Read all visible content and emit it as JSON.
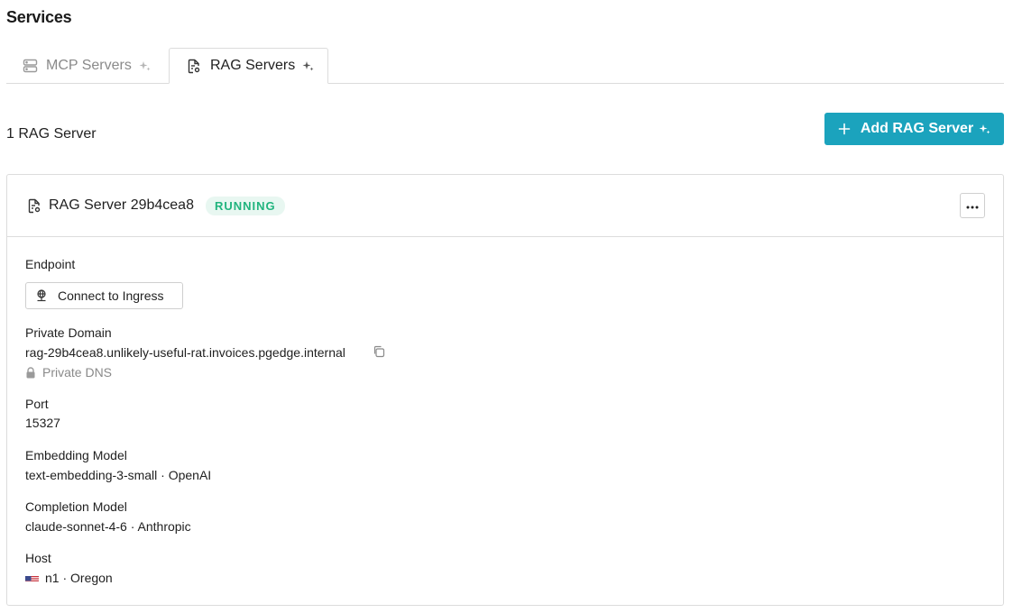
{
  "page": {
    "title": "Services"
  },
  "tabs": [
    {
      "label": "MCP Servers",
      "icon": "server-icon",
      "active": false
    },
    {
      "label": "RAG Servers",
      "icon": "file-gear-icon",
      "active": true
    }
  ],
  "summary": {
    "count_label": "1 RAG Server"
  },
  "add_button": {
    "label": "Add RAG Server",
    "color": "#1ba3bd"
  },
  "server": {
    "title": "RAG Server 29b4cea8",
    "status": "RUNNING",
    "status_color": "#21b47e",
    "endpoint": {
      "label": "Endpoint",
      "button_label": "Connect to Ingress"
    },
    "private_domain": {
      "label": "Private Domain",
      "value": "rag-29b4cea8.unlikely-useful-rat.invoices.pgedge.internal",
      "note": "Private DNS"
    },
    "port": {
      "label": "Port",
      "value": "15327"
    },
    "embedding_model": {
      "label": "Embedding Model",
      "value": "text-embedding-3-small · OpenAI"
    },
    "completion_model": {
      "label": "Completion Model",
      "value": "claude-sonnet-4-6 · Anthropic"
    },
    "host": {
      "label": "Host",
      "value": "n1 · Oregon",
      "flag": "us-flag-icon"
    }
  }
}
